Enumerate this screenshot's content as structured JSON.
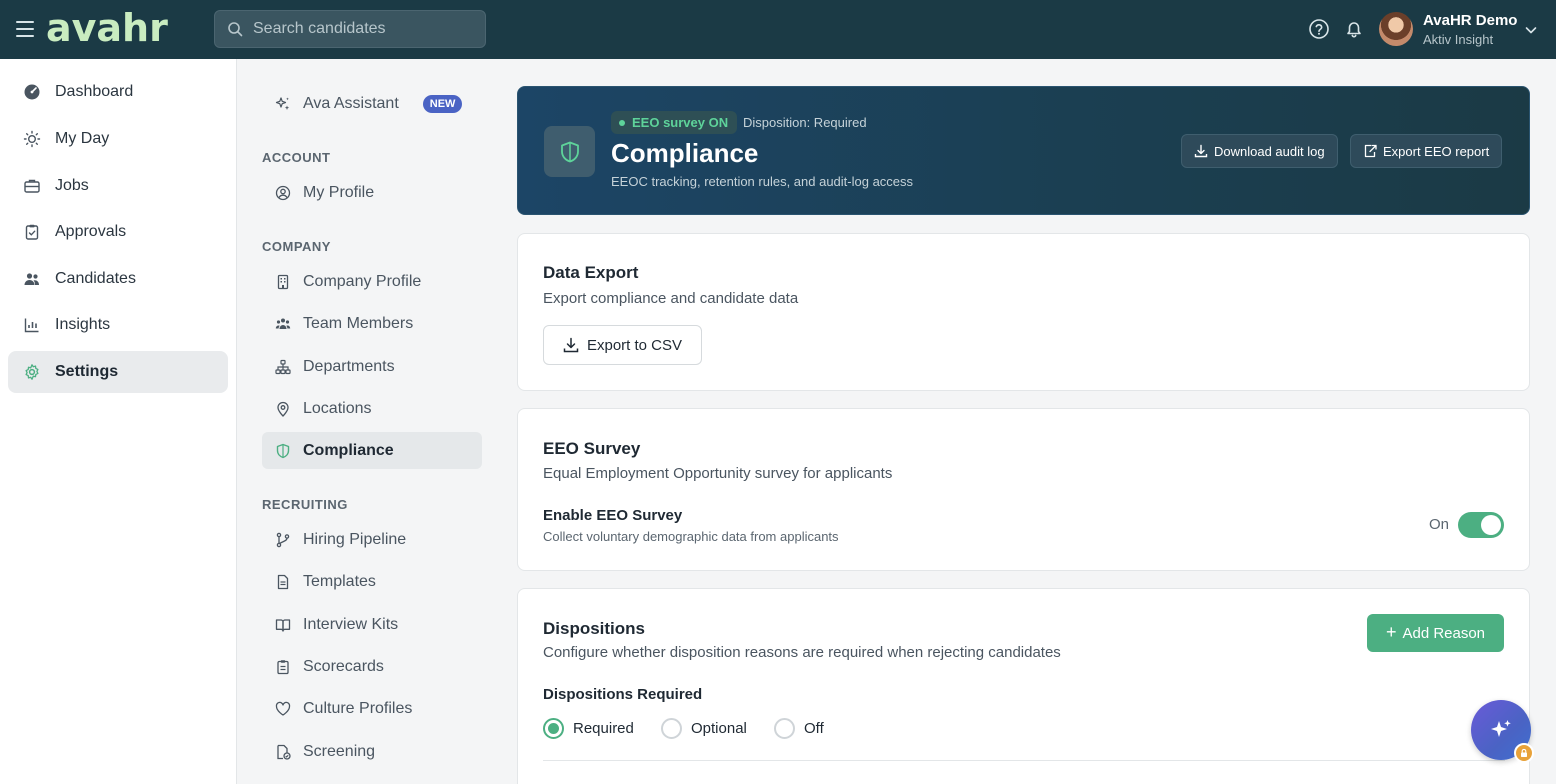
{
  "app": {
    "logo": "avahr",
    "search_placeholder": "Search candidates",
    "user": {
      "name": "AvaHR Demo",
      "org": "Aktiv Insight"
    }
  },
  "leftnav": {
    "items": [
      {
        "label": "Dashboard",
        "icon": "dashboard-icon"
      },
      {
        "label": "My Day",
        "icon": "sun-icon"
      },
      {
        "label": "Jobs",
        "icon": "briefcase-icon"
      },
      {
        "label": "Approvals",
        "icon": "clipboard-check-icon"
      },
      {
        "label": "Candidates",
        "icon": "users-icon"
      },
      {
        "label": "Insights",
        "icon": "bar-chart-icon"
      },
      {
        "label": "Settings",
        "icon": "gear-icon",
        "active": true
      }
    ]
  },
  "subnav": {
    "assistant": {
      "label": "Ava Assistant",
      "badge": "NEW"
    },
    "account": {
      "heading": "ACCOUNT",
      "items": [
        {
          "label": "My Profile"
        }
      ]
    },
    "company": {
      "heading": "COMPANY",
      "items": [
        {
          "label": "Company Profile"
        },
        {
          "label": "Team Members"
        },
        {
          "label": "Departments"
        },
        {
          "label": "Locations"
        },
        {
          "label": "Compliance",
          "active": true
        }
      ]
    },
    "recruiting": {
      "heading": "RECRUITING",
      "items": [
        {
          "label": "Hiring Pipeline"
        },
        {
          "label": "Templates"
        },
        {
          "label": "Interview Kits"
        },
        {
          "label": "Scorecards"
        },
        {
          "label": "Culture Profiles"
        },
        {
          "label": "Screening"
        }
      ]
    }
  },
  "hero": {
    "pill": "EEO survey ON",
    "disposition": "Disposition: Required",
    "title": "Compliance",
    "subtitle": "EEOC tracking, retention rules, and audit-log access",
    "download_label": "Download audit log",
    "export_label": "Export EEO report"
  },
  "data_export": {
    "title": "Data Export",
    "subtitle": "Export compliance and candidate data",
    "button": "Export to CSV"
  },
  "eeo_survey": {
    "title": "EEO Survey",
    "subtitle": "Equal Employment Opportunity survey for applicants",
    "toggle_label": "Enable EEO Survey",
    "toggle_sub": "Collect voluntary demographic data from applicants",
    "toggle_state": "On"
  },
  "dispositions": {
    "title": "Dispositions",
    "subtitle": "Configure whether disposition reasons are required when rejecting candidates",
    "add_button": "Add Reason",
    "radio_heading": "Dispositions Required",
    "options": [
      "Required",
      "Optional",
      "Off"
    ],
    "selected": "Required"
  },
  "colors": {
    "topbar": "#1b3a45",
    "accent_green": "#4caf82",
    "logo": "#c9ecc0",
    "fab": "#4a63c4"
  }
}
